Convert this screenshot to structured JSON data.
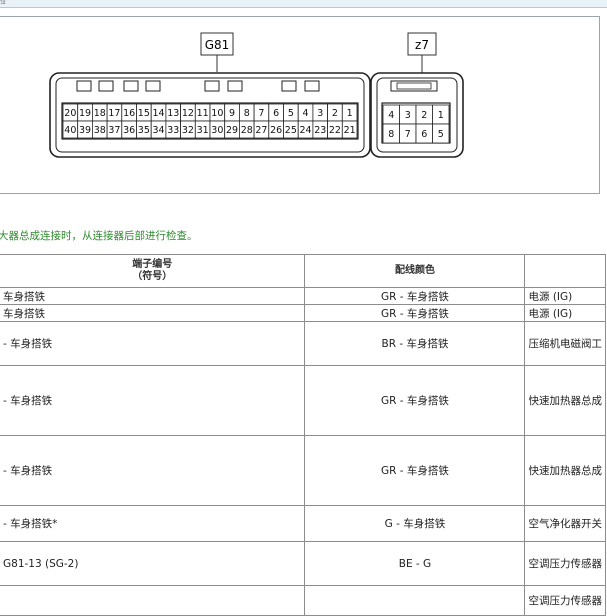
{
  "header": {
    "corner_text": "检"
  },
  "diagram": {
    "connector_g81": {
      "label": "G81",
      "row_top": [
        "20",
        "19",
        "18",
        "17",
        "16",
        "15",
        "14",
        "13",
        "12",
        "11",
        "10",
        "9",
        "8",
        "7",
        "6",
        "5",
        "4",
        "3",
        "2",
        "1"
      ],
      "row_bottom": [
        "40",
        "39",
        "38",
        "37",
        "36",
        "35",
        "34",
        "33",
        "32",
        "31",
        "30",
        "29",
        "28",
        "27",
        "26",
        "25",
        "24",
        "23",
        "22",
        "21"
      ]
    },
    "connector_z7": {
      "label": "z7",
      "row_top": [
        "4",
        "3",
        "2",
        "1"
      ],
      "row_bottom": [
        "8",
        "7",
        "6",
        "5"
      ]
    }
  },
  "note": "大器总成连接时，从连接器后部进行检查。",
  "table": {
    "headers": {
      "terminal_line1": "端子编号",
      "terminal_line2": "（符号）",
      "wire_color": "配线颜色",
      "desc": ""
    },
    "rows": [
      {
        "terminal": "车身搭铁",
        "color": "GR - 车身搭铁",
        "desc": "电源 (IG)"
      },
      {
        "terminal": "车身搭铁",
        "color": "GR - 车身搭铁",
        "desc": "电源 (IG)"
      },
      {
        "terminal": "- 车身搭铁",
        "color": "BR - 车身搭铁",
        "desc": "压缩机电磁阀工"
      },
      {
        "terminal": "- 车身搭铁",
        "color": "GR - 车身搭铁",
        "desc": "快速加热器总成"
      },
      {
        "terminal": "- 车身搭铁",
        "color": "GR - 车身搭铁",
        "desc": "快速加热器总成"
      },
      {
        "terminal": "- 车身搭铁*",
        "color": "G - 车身搭铁",
        "desc": "空气净化器开关"
      },
      {
        "terminal": "G81-13 (SG-2)",
        "color": "BE - G",
        "desc": "空调压力传感器"
      },
      {
        "terminal": "",
        "color": "",
        "desc": "空调压力传感器"
      }
    ]
  }
}
